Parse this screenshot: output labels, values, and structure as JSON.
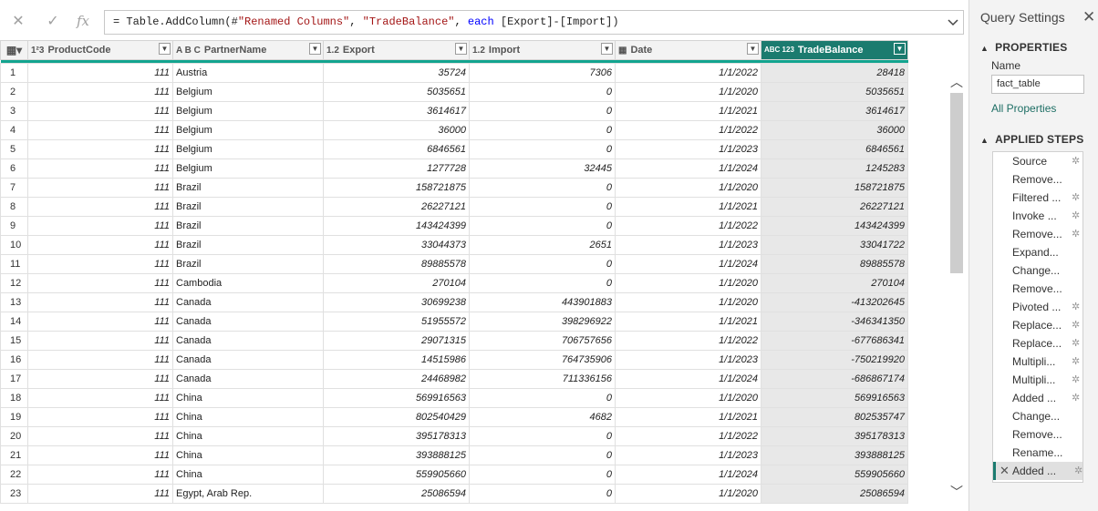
{
  "formula_bar": {
    "formula_parts": {
      "p1": "= Table.AddColumn(#",
      "s1": "\"Renamed Columns\"",
      "p2": ", ",
      "s2": "\"TradeBalance\"",
      "p3": ", ",
      "k1": "each",
      "p4": " [Export]-[Import])"
    },
    "fx_label": "fx"
  },
  "columns": [
    {
      "type_icon": "1²3",
      "label": "ProductCode"
    },
    {
      "type_icon": "A B C",
      "label": "PartnerName"
    },
    {
      "type_icon": "1.2",
      "label": "Export"
    },
    {
      "type_icon": "1.2",
      "label": "Import"
    },
    {
      "type_icon": "▦",
      "label": "Date"
    },
    {
      "type_icon": "ABC 123",
      "label": "TradeBalance"
    }
  ],
  "rows": [
    [
      "1",
      "111",
      "Austria",
      "35724",
      "7306",
      "1/1/2022",
      "28418"
    ],
    [
      "2",
      "111",
      "Belgium",
      "5035651",
      "0",
      "1/1/2020",
      "5035651"
    ],
    [
      "3",
      "111",
      "Belgium",
      "3614617",
      "0",
      "1/1/2021",
      "3614617"
    ],
    [
      "4",
      "111",
      "Belgium",
      "36000",
      "0",
      "1/1/2022",
      "36000"
    ],
    [
      "5",
      "111",
      "Belgium",
      "6846561",
      "0",
      "1/1/2023",
      "6846561"
    ],
    [
      "6",
      "111",
      "Belgium",
      "1277728",
      "32445",
      "1/1/2024",
      "1245283"
    ],
    [
      "7",
      "111",
      "Brazil",
      "158721875",
      "0",
      "1/1/2020",
      "158721875"
    ],
    [
      "8",
      "111",
      "Brazil",
      "26227121",
      "0",
      "1/1/2021",
      "26227121"
    ],
    [
      "9",
      "111",
      "Brazil",
      "143424399",
      "0",
      "1/1/2022",
      "143424399"
    ],
    [
      "10",
      "111",
      "Brazil",
      "33044373",
      "2651",
      "1/1/2023",
      "33041722"
    ],
    [
      "11",
      "111",
      "Brazil",
      "89885578",
      "0",
      "1/1/2024",
      "89885578"
    ],
    [
      "12",
      "111",
      "Cambodia",
      "270104",
      "0",
      "1/1/2020",
      "270104"
    ],
    [
      "13",
      "111",
      "Canada",
      "30699238",
      "443901883",
      "1/1/2020",
      "-413202645"
    ],
    [
      "14",
      "111",
      "Canada",
      "51955572",
      "398296922",
      "1/1/2021",
      "-346341350"
    ],
    [
      "15",
      "111",
      "Canada",
      "29071315",
      "706757656",
      "1/1/2022",
      "-677686341"
    ],
    [
      "16",
      "111",
      "Canada",
      "14515986",
      "764735906",
      "1/1/2023",
      "-750219920"
    ],
    [
      "17",
      "111",
      "Canada",
      "24468982",
      "711336156",
      "1/1/2024",
      "-686867174"
    ],
    [
      "18",
      "111",
      "China",
      "569916563",
      "0",
      "1/1/2020",
      "569916563"
    ],
    [
      "19",
      "111",
      "China",
      "802540429",
      "4682",
      "1/1/2021",
      "802535747"
    ],
    [
      "20",
      "111",
      "China",
      "395178313",
      "0",
      "1/1/2022",
      "395178313"
    ],
    [
      "21",
      "111",
      "China",
      "393888125",
      "0",
      "1/1/2023",
      "393888125"
    ],
    [
      "22",
      "111",
      "China",
      "559905660",
      "0",
      "1/1/2024",
      "559905660"
    ],
    [
      "23",
      "111",
      "Egypt, Arab Rep.",
      "25086594",
      "0",
      "1/1/2020",
      "25086594"
    ]
  ],
  "query_settings": {
    "title": "Query Settings",
    "properties_header": "PROPERTIES",
    "name_label": "Name",
    "name_value": "fact_table",
    "all_properties": "All Properties",
    "applied_steps_header": "APPLIED STEPS",
    "steps": [
      {
        "label": "Source",
        "gear": true
      },
      {
        "label": "Remove...",
        "gear": false
      },
      {
        "label": "Filtered ...",
        "gear": true
      },
      {
        "label": "Invoke ...",
        "gear": true
      },
      {
        "label": "Remove...",
        "gear": true
      },
      {
        "label": "Expand...",
        "gear": false
      },
      {
        "label": "Change...",
        "gear": false
      },
      {
        "label": "Remove...",
        "gear": false
      },
      {
        "label": "Pivoted ...",
        "gear": true
      },
      {
        "label": "Replace...",
        "gear": true
      },
      {
        "label": "Replace...",
        "gear": true
      },
      {
        "label": "Multipli...",
        "gear": true
      },
      {
        "label": "Multipli...",
        "gear": true
      },
      {
        "label": "Added ...",
        "gear": true
      },
      {
        "label": "Change...",
        "gear": false
      },
      {
        "label": "Remove...",
        "gear": false
      },
      {
        "label": "Rename...",
        "gear": false
      },
      {
        "label": "Added ...",
        "gear": true,
        "active": true
      }
    ]
  }
}
